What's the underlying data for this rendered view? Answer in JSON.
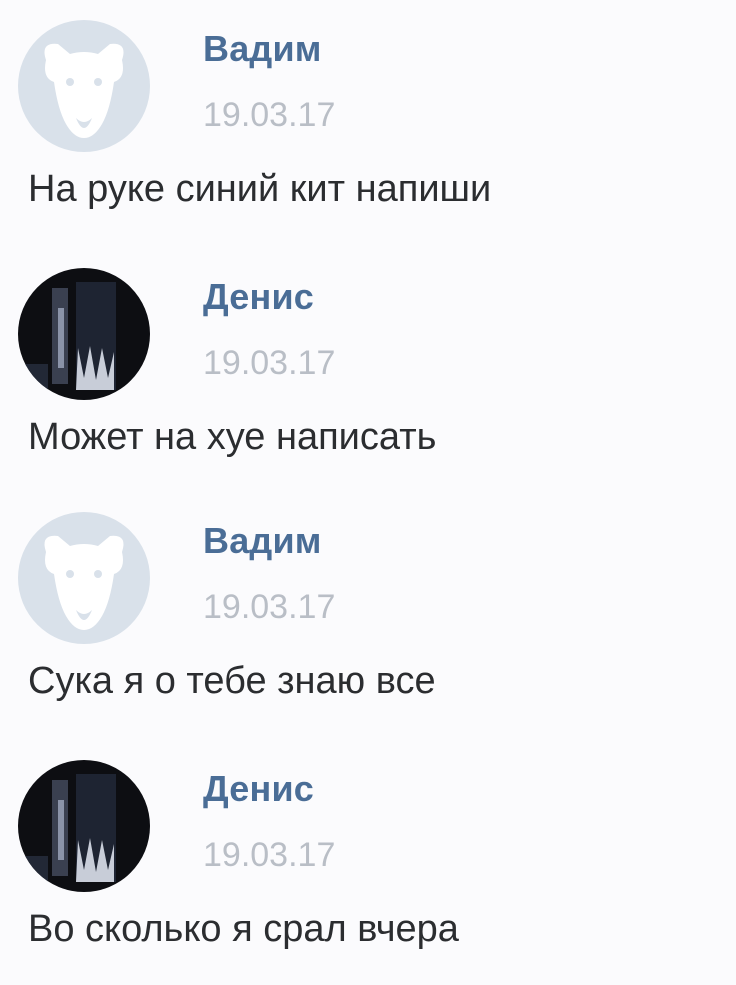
{
  "messages": [
    {
      "author": "Вадим",
      "date": "19.03.17",
      "text": "На руке синий кит напиши",
      "avatar": "default-dog-avatar"
    },
    {
      "author": "Денис",
      "date": "19.03.17",
      "text": "Может на хуе написать",
      "avatar": "dark-photo-avatar"
    },
    {
      "author": "Вадим",
      "date": "19.03.17",
      "text": "Сука я о тебе знаю все",
      "avatar": "default-dog-avatar"
    },
    {
      "author": "Денис",
      "date": "19.03.17",
      "text": "Во сколько я срал вчера",
      "avatar": "dark-photo-avatar"
    }
  ],
  "colors": {
    "background": "#fbfbfd",
    "author_link": "#4a6d96",
    "date": "#b9bec6",
    "message_text": "#2b2d30",
    "default_avatar_bg": "#d9e1ea"
  }
}
